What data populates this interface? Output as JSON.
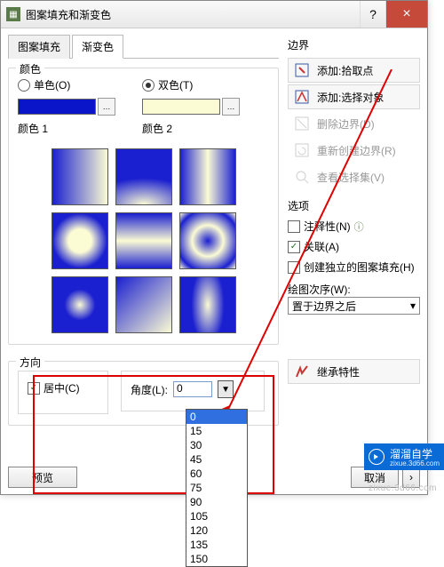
{
  "window": {
    "title": "图案填充和渐变色",
    "help": "?",
    "close": "×"
  },
  "tabs": [
    {
      "label": "图案填充"
    },
    {
      "label": "渐变色"
    }
  ],
  "color_group": {
    "title": "颜色",
    "single": {
      "label": "单色(O)",
      "swatch_label": "颜色 1"
    },
    "double": {
      "label": "双色(T)",
      "swatch_label": "颜色 2"
    }
  },
  "direction": {
    "title": "方向",
    "center": "居中(C)",
    "angle": "角度(L):",
    "value": "0",
    "options": [
      "0",
      "15",
      "30",
      "45",
      "60",
      "75",
      "90",
      "105",
      "120",
      "135",
      "150"
    ]
  },
  "boundary": {
    "title": "边界",
    "add_pick": "添加:拾取点",
    "add_select": "添加:选择对象",
    "remove": "删除边界(D)",
    "recreate": "重新创建边界(R)",
    "view_sel": "查看选择集(V)"
  },
  "options": {
    "title": "选项",
    "annotative": "注释性(N)",
    "associative": "关联(A)",
    "independent": "创建独立的图案填充(H)",
    "draw_order": "绘图次序(W):",
    "draw_order_value": "置于边界之后"
  },
  "inherit": "继承特性",
  "footer": {
    "preview": "预览",
    "cancel": "取消"
  },
  "brand": {
    "name": "溜溜自学",
    "sub": "zixue.3d66.com"
  },
  "watermark": "zixue.3d66.com"
}
